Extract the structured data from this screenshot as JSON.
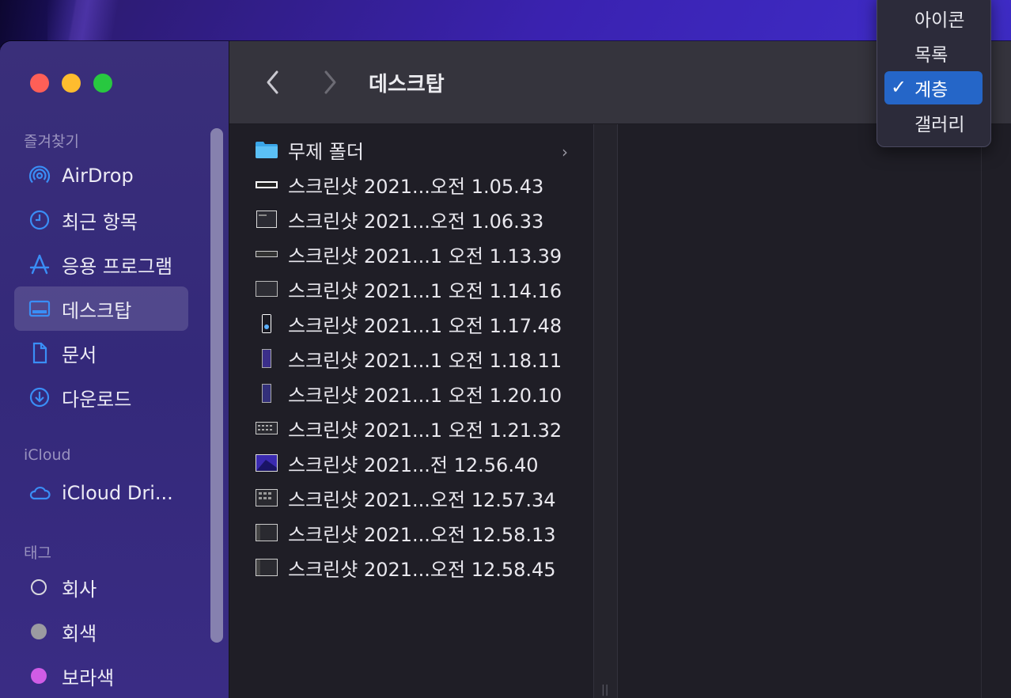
{
  "window": {
    "title": "데스크탑"
  },
  "sidebar": {
    "sections": [
      {
        "label": "즐겨찾기"
      },
      {
        "label": "iCloud"
      },
      {
        "label": "태그"
      }
    ],
    "favorites": [
      {
        "label": "AirDrop",
        "icon": "airdrop-icon"
      },
      {
        "label": "최근 항목",
        "icon": "clock-icon"
      },
      {
        "label": "응용 프로그램",
        "icon": "applications-icon"
      },
      {
        "label": "데스크탑",
        "icon": "desktop-icon",
        "selected": true
      },
      {
        "label": "문서",
        "icon": "document-icon"
      },
      {
        "label": "다운로드",
        "icon": "download-icon"
      }
    ],
    "icloud": [
      {
        "label": "iCloud Dri...",
        "icon": "cloud-icon"
      }
    ],
    "tags": [
      {
        "label": "회사",
        "color": "#ffffff"
      },
      {
        "label": "회색",
        "color": "#9b9ba1"
      },
      {
        "label": "보라색",
        "color": "#d05ce6"
      }
    ]
  },
  "files": [
    {
      "name": "무제 폴더",
      "type": "folder"
    },
    {
      "name": "스크린샷 2021...오전 1.05.43",
      "type": "image"
    },
    {
      "name": "스크린샷 2021...오전 1.06.33",
      "type": "image"
    },
    {
      "name": "스크린샷 2021...1 오전 1.13.39",
      "type": "image"
    },
    {
      "name": "스크린샷 2021...1 오전 1.14.16",
      "type": "image"
    },
    {
      "name": "스크린샷 2021...1 오전 1.17.48",
      "type": "image"
    },
    {
      "name": "스크린샷 2021...1 오전 1.18.11",
      "type": "image"
    },
    {
      "name": "스크린샷 2021...1 오전 1.20.10",
      "type": "image"
    },
    {
      "name": "스크린샷 2021...1 오전 1.21.32",
      "type": "image"
    },
    {
      "name": "스크린샷 2021...전 12.56.40",
      "type": "image"
    },
    {
      "name": "스크린샷 2021...오전 12.57.34",
      "type": "image"
    },
    {
      "name": "스크린샷 2021...오전 12.58.13",
      "type": "image"
    },
    {
      "name": "스크린샷 2021...오전 12.58.45",
      "type": "image"
    }
  ],
  "view_menu": {
    "items": [
      {
        "label": "아이콘",
        "checked": false
      },
      {
        "label": "목록",
        "checked": false
      },
      {
        "label": "계층",
        "checked": true
      },
      {
        "label": "갤러리",
        "checked": false
      }
    ],
    "check_glyph": "✓"
  },
  "colors": {
    "accent": "#2566c8",
    "sidebar_icon": "#3a8ef6"
  }
}
